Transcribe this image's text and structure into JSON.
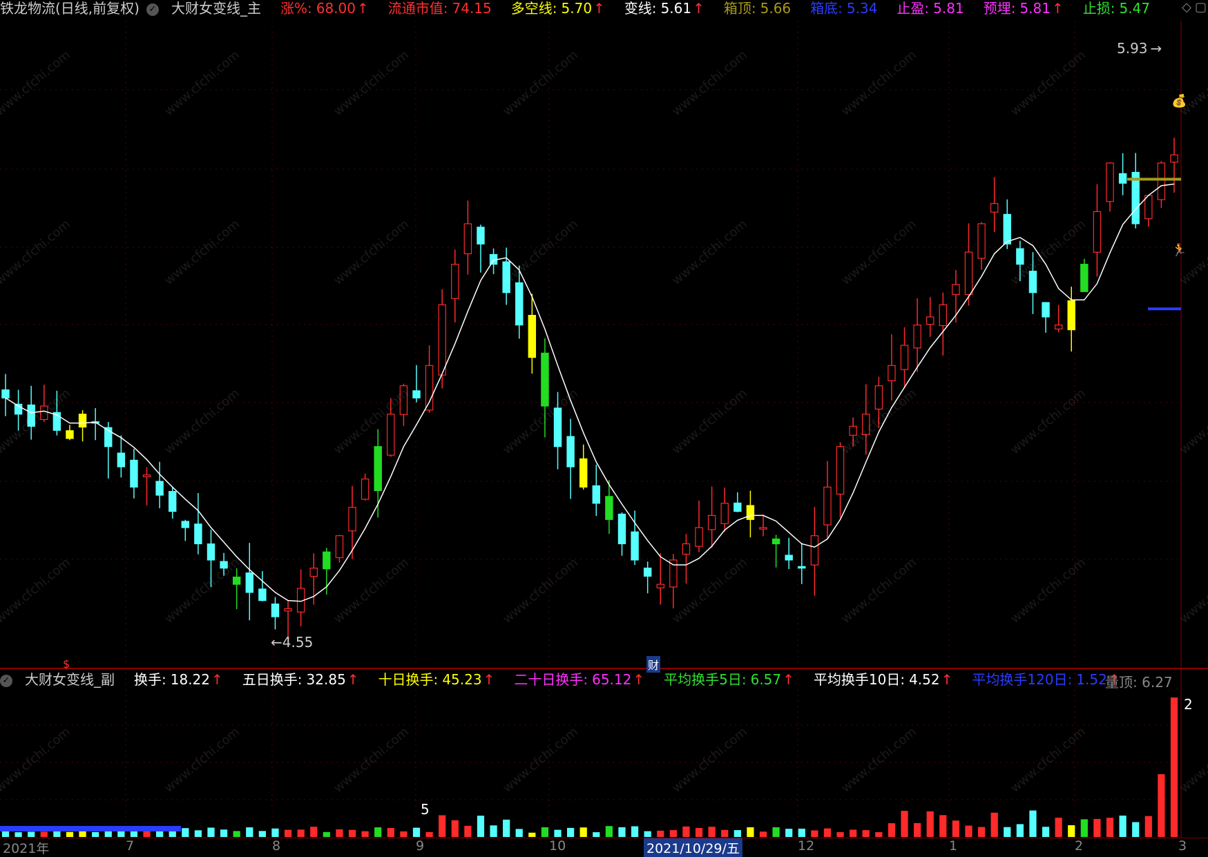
{
  "main_header": {
    "stock_name": "铁龙物流(日线,前复权)",
    "indicator_name": "大财女变线_主",
    "items": [
      {
        "label": "涨%:",
        "value": "68.00",
        "color": "#ff3030",
        "arrow": "↑"
      },
      {
        "label": "流通市值:",
        "value": "74.15",
        "color": "#ff3030",
        "arrow": ""
      },
      {
        "label": "多空线:",
        "value": "5.70",
        "color": "#ffff00",
        "arrow": "↑"
      },
      {
        "label": "变线:",
        "value": "5.61",
        "color": "#ffffff",
        "arrow": "↑"
      },
      {
        "label": "箱顶:",
        "value": "5.66",
        "color": "#a89a18",
        "arrow": ""
      },
      {
        "label": "箱底:",
        "value": "5.34",
        "color": "#2a3cff",
        "arrow": ""
      },
      {
        "label": "止盈:",
        "value": "5.81",
        "color": "#ff30ff",
        "arrow": ""
      },
      {
        "label": "预埋:",
        "value": "5.81",
        "color": "#ff30ff",
        "arrow": "↑"
      },
      {
        "label": "止损:",
        "value": "5.47",
        "color": "#30e030",
        "arrow": ""
      }
    ]
  },
  "sub_header": {
    "indicator_name": "大财女变线_副",
    "items": [
      {
        "label": "换手:",
        "value": "18.22",
        "color": "#ffffff",
        "arrow": "↑"
      },
      {
        "label": "五日换手:",
        "value": "32.85",
        "color": "#ffffff",
        "arrow": "↑"
      },
      {
        "label": "十日换手:",
        "value": "45.23",
        "color": "#ffff00",
        "arrow": "↑"
      },
      {
        "label": "二十日换手:",
        "value": "65.12",
        "color": "#ff30ff",
        "arrow": "↑"
      },
      {
        "label": "平均换手5日:",
        "value": "6.57",
        "color": "#30e030",
        "arrow": "↑"
      },
      {
        "label": "平均换手10日:",
        "value": "4.52",
        "color": "#ffffff",
        "arrow": "↑"
      },
      {
        "label": "平均换手120日:",
        "value": "1.52",
        "color": "#2a3cff",
        "arrow": "↑"
      }
    ],
    "volume_top_label": "量顶:",
    "volume_top_value": "6.27"
  },
  "annotations": {
    "high_price": "5.93",
    "low_price": "4.55",
    "caifu_marker": "财",
    "dollar_marker": "$",
    "sub_label_5": "5",
    "sub_label_2": "2"
  },
  "date_axis": {
    "labels": [
      "2021年",
      "7",
      "8",
      "9",
      "10",
      "2021/10/29/五",
      "12",
      "1",
      "2",
      "3"
    ]
  },
  "chart_data": {
    "type": "candlestick",
    "symbol": "铁龙物流",
    "period": "日线",
    "high": 5.93,
    "low": 4.55,
    "ylim": [
      4.5,
      6.0
    ],
    "price_path": [
      5.12,
      5.08,
      5.05,
      5.1,
      5.04,
      5.02,
      5.08,
      5.06,
      5.0,
      4.95,
      4.9,
      4.93,
      4.88,
      4.84,
      4.8,
      4.76,
      4.72,
      4.7,
      4.66,
      4.64,
      4.62,
      4.58,
      4.6,
      4.65,
      4.7,
      4.74,
      4.78,
      4.85,
      4.92,
      5.0,
      5.08,
      5.15,
      5.12,
      5.2,
      5.35,
      5.45,
      5.55,
      5.5,
      5.45,
      5.38,
      5.3,
      5.22,
      5.1,
      5.0,
      4.95,
      4.9,
      4.86,
      4.82,
      4.76,
      4.72,
      4.68,
      4.66,
      4.72,
      4.76,
      4.8,
      4.83,
      4.86,
      4.84,
      4.82,
      4.8,
      4.76,
      4.72,
      4.7,
      4.78,
      4.9,
      5.0,
      5.05,
      5.08,
      5.15,
      5.2,
      5.25,
      5.3,
      5.32,
      5.35,
      5.4,
      5.48,
      5.55,
      5.6,
      5.5,
      5.45,
      5.38,
      5.32,
      5.3,
      5.36,
      5.45,
      5.58,
      5.7,
      5.65,
      5.55,
      5.62,
      5.7,
      5.72
    ]
  },
  "colors": {
    "up": "#ff2a2a",
    "down": "#55ffff",
    "yellow": "#ffff00",
    "green": "#22dd22",
    "ma_line": "#ffffff",
    "volume_blue": "#2a3cff"
  }
}
